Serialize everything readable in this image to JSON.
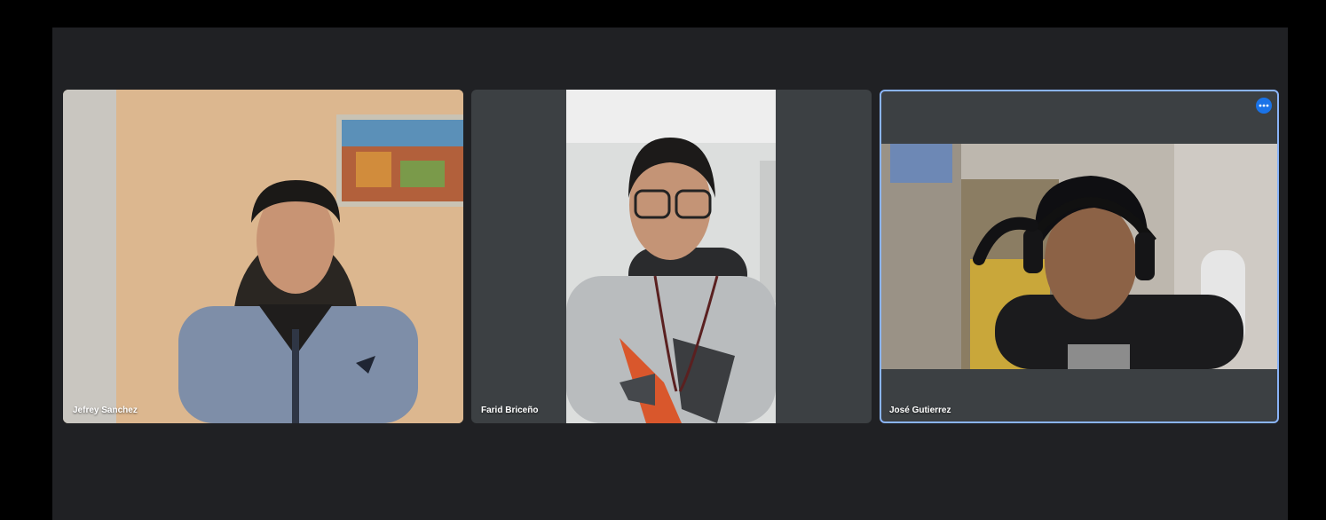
{
  "meeting": {
    "participants": [
      {
        "name": "Jefrey Sanchez",
        "active_speaker": false
      },
      {
        "name": "Farid Briceño",
        "active_speaker": false
      },
      {
        "name": "José Gutierrez",
        "active_speaker": true,
        "more_options_icon": "more-horiz-icon"
      }
    ]
  },
  "colors": {
    "page_background": "#000000",
    "stage_background": "#202124",
    "tile_background": "#3c4043",
    "active_border": "#8ab4f8",
    "menu_button": "#1a73e8"
  }
}
